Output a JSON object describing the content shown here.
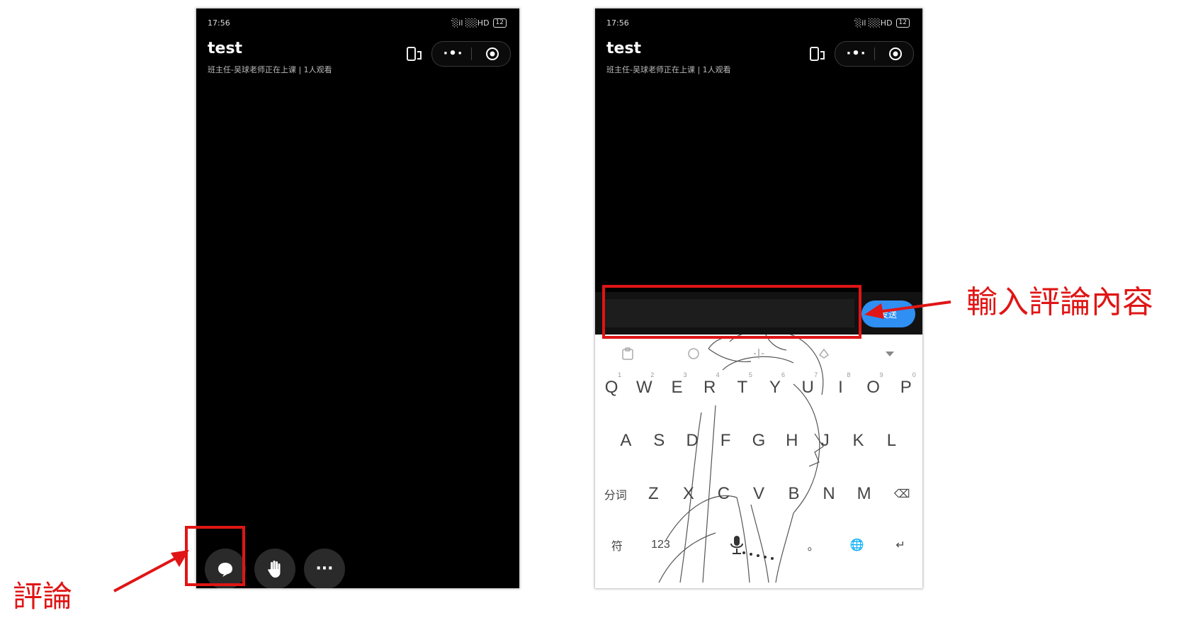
{
  "left_screen": {
    "status": {
      "time": "17:56",
      "signal": "′░il ░░HD",
      "battery": "12"
    },
    "title": "test",
    "subtitle": "班主任-吴球老师正在上课 | 1人观看",
    "bottom_actions": {
      "comment": "comment-icon",
      "hand": "raise-hand-icon",
      "more": "···"
    }
  },
  "right_screen": {
    "status": {
      "time": "17:56",
      "signal": "′░il ░░HD",
      "battery": "12"
    },
    "title": "test",
    "subtitle": "班主任-吴球老师正在上课 | 1人观看",
    "comment_input": {
      "value": "",
      "placeholder": ""
    },
    "send_label": "发送",
    "keyboard": {
      "row1": [
        {
          "key": "Q",
          "hint": "1"
        },
        {
          "key": "W",
          "hint": "2"
        },
        {
          "key": "E",
          "hint": "3"
        },
        {
          "key": "R",
          "hint": "4"
        },
        {
          "key": "T",
          "hint": "5"
        },
        {
          "key": "Y",
          "hint": "6"
        },
        {
          "key": "U",
          "hint": "7"
        },
        {
          "key": "I",
          "hint": "8"
        },
        {
          "key": "O",
          "hint": "9"
        },
        {
          "key": "P",
          "hint": "0"
        }
      ],
      "row2": [
        "A",
        "S",
        "D",
        "F",
        "G",
        "H",
        "J",
        "K",
        "L"
      ],
      "row3": [
        "分词",
        "Z",
        "X",
        "C",
        "V",
        "B",
        "N",
        "M",
        "⌫"
      ],
      "row4": {
        "symbols": "符",
        "numbers": "123",
        "space": "",
        "period": "。",
        "language": "🌐",
        "enter": "↵"
      }
    }
  },
  "annotations": {
    "comment_label": "評論",
    "input_label": "輸入評論內容"
  },
  "colors": {
    "highlight": "#e01515",
    "send_button": "#2f8ff2"
  }
}
